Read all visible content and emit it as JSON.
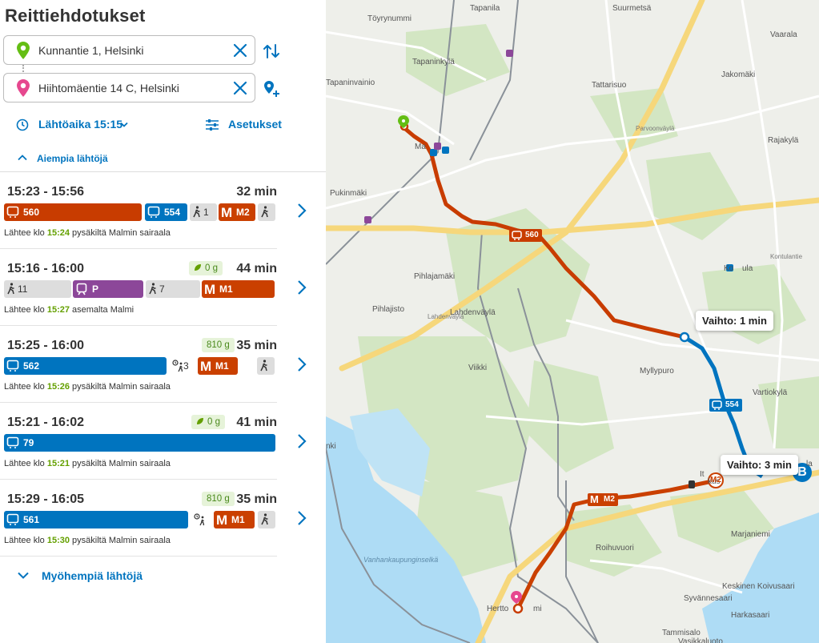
{
  "panel": {
    "title": "Reittiehdotukset",
    "origin": "Kunnantie 1, Helsinki",
    "destination": "Hiihtomäentie 14 C, Helsinki",
    "departure_label": "Lähtöaika 15:15",
    "settings_label": "Asetukset",
    "earlier_label": "Aiempia lähtöjä",
    "later_label": "Myöhempiä lähtöjä"
  },
  "colors": {
    "bus": "#0074bf",
    "trunk_bus": "#c83c00",
    "metro": "#ca4000",
    "train": "#8c4799",
    "walk": "#dddddd",
    "accent": "#0074bf"
  },
  "itineraries": [
    {
      "time": "15:23 - 15:56",
      "duration": "32 min",
      "co2": "",
      "dep_prefix": "Lähtee klo ",
      "dep_time": "15:24",
      "dep_suffix": " pysäkiltä Malmin sairaala",
      "legs": [
        {
          "mode": "trunk_bus",
          "label": "560",
          "icon": "bus-icon"
        },
        {
          "mode": "bus",
          "label": "554",
          "icon": "bus-icon"
        },
        {
          "mode": "walk",
          "label": "1",
          "icon": "walk-icon"
        },
        {
          "mode": "metro",
          "label": "M2",
          "icon": "metro-icon"
        },
        {
          "mode": "walk",
          "label": "",
          "icon": "walk-icon"
        }
      ]
    },
    {
      "time": "15:16 - 16:00",
      "duration": "44 min",
      "co2": "0 g",
      "dep_prefix": "Lähtee klo ",
      "dep_time": "15:27",
      "dep_suffix": " asemalta Malmi",
      "legs": [
        {
          "mode": "walk",
          "label": "11",
          "icon": "walk-icon"
        },
        {
          "mode": "train",
          "label": "P",
          "icon": "train-icon"
        },
        {
          "mode": "walk",
          "label": "7",
          "icon": "walk-icon"
        },
        {
          "mode": "metro",
          "label": "M1",
          "icon": "metro-icon"
        }
      ]
    },
    {
      "time": "15:25 - 16:00",
      "duration": "35 min",
      "co2": "810 g",
      "dep_prefix": "Lähtee klo ",
      "dep_time": "15:26",
      "dep_suffix": " pysäkiltä Malmin sairaala",
      "legs": [
        {
          "mode": "bus",
          "label": "562",
          "icon": "bus-icon"
        },
        {
          "mode": "wait",
          "label": "3",
          "icon": "wait-walk-icon"
        },
        {
          "mode": "metro",
          "label": "M1",
          "icon": "metro-icon"
        },
        {
          "mode": "walk",
          "label": "",
          "icon": "walk-icon"
        }
      ]
    },
    {
      "time": "15:21 - 16:02",
      "duration": "41 min",
      "co2": "0 g",
      "dep_prefix": "Lähtee klo ",
      "dep_time": "15:21",
      "dep_suffix": " pysäkiltä Malmin sairaala",
      "legs": [
        {
          "mode": "bus",
          "label": "79",
          "icon": "bus-icon"
        }
      ]
    },
    {
      "time": "15:29 - 16:05",
      "duration": "35 min",
      "co2": "810 g",
      "dep_prefix": "Lähtee klo ",
      "dep_time": "15:30",
      "dep_suffix": " pysäkiltä Malmin sairaala",
      "legs": [
        {
          "mode": "bus",
          "label": "561",
          "icon": "bus-icon"
        },
        {
          "mode": "wait",
          "label": "",
          "icon": "wait-walk-icon"
        },
        {
          "mode": "metro",
          "label": "M1",
          "icon": "metro-icon"
        },
        {
          "mode": "walk",
          "label": "",
          "icon": "walk-icon"
        }
      ]
    }
  ],
  "map": {
    "places": [
      "Töyrynummi",
      "Tapanila",
      "Suurmetsä",
      "Vaarala",
      "Tapaninkylä",
      "Jakomäki",
      "Tapaninvainio",
      "Tattarisuo",
      "Rajakylä",
      "Ma",
      "Pukinmäki",
      "Kontulantie",
      "Pihlajamäki",
      "Ko",
      "ula",
      "Pihlajisto",
      "Lahdenväylä",
      "Viikki",
      "Myllypuro",
      "Vartiokylä",
      "nki",
      "It",
      "kus",
      "Marjaniemi",
      "Roihuvuori",
      "Vanhankaupunginselkä",
      "Hertto",
      "mi",
      "Keskinen Koivusaari",
      "Syvännesaari",
      "Harkasaari",
      "Tammisalo",
      "Vasikkaluoto",
      "Parvoonväylä",
      "Lahdenväylä",
      "la"
    ],
    "transfer1": "Vaihto: 1 min",
    "transfer2": "Vaihto: 3 min",
    "route_560": "560",
    "route_554": "554",
    "route_m2": "M2",
    "metro_station": "M2",
    "destination_marker": "B"
  }
}
